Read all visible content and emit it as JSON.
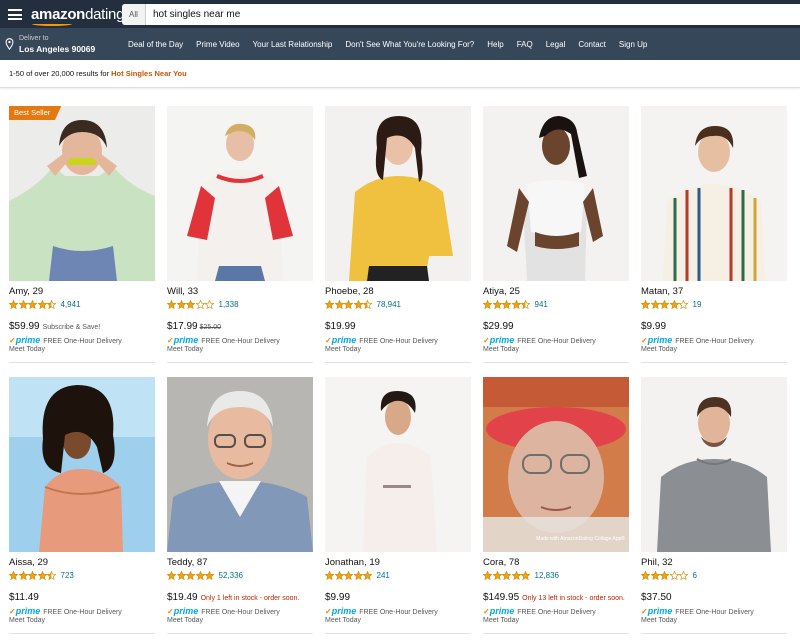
{
  "header": {
    "logo_brand": "amazon",
    "logo_suffix": "dating",
    "search_scope": "All",
    "search_query": "hot singles near me"
  },
  "nav": {
    "deliver_label": "Deliver to",
    "deliver_location": "Los Angeles 90069",
    "links": [
      "Deal of the Day",
      "Prime Video",
      "Your Last Relationship",
      "Don't See What You're Looking For?",
      "Help",
      "FAQ",
      "Legal",
      "Contact",
      "Sign Up"
    ]
  },
  "results": {
    "summary": "1-50 of over 20,000 results for ",
    "query": "Hot Singles Near You"
  },
  "common": {
    "prime_check": "✓",
    "prime_word": "prime",
    "delivery": "FREE One-Hour Delivery",
    "meet": "Meet Today"
  },
  "colors": {
    "header_bg": "#232f3e",
    "nav_bg": "#37475a",
    "accent_orange": "#e47911",
    "query_orange": "#c45500",
    "link_teal": "#007185",
    "prime_blue": "#00a8e1",
    "star_gold": "#f0a30e",
    "stock_red": "#b12704"
  },
  "products": [
    {
      "name": "Amy, 29",
      "stars": 4.5,
      "reviews": "4,941",
      "price": "$59.99",
      "old_price": "",
      "note": "Subscribe & Save!",
      "note_style": "gray",
      "badge": "Best Seller",
      "caption": ""
    },
    {
      "name": "Will, 33",
      "stars": 3,
      "reviews": "1,338",
      "price": "$17.99",
      "old_price": "$25.00",
      "note": "",
      "note_style": "",
      "badge": "",
      "caption": ""
    },
    {
      "name": "Phoebe, 28",
      "stars": 4.5,
      "reviews": "78,941",
      "price": "$19.99",
      "old_price": "",
      "note": "",
      "note_style": "",
      "badge": "",
      "caption": ""
    },
    {
      "name": "Atiya, 25",
      "stars": 4.5,
      "reviews": "941",
      "price": "$29.99",
      "old_price": "",
      "note": "",
      "note_style": "",
      "badge": "",
      "caption": ""
    },
    {
      "name": "Matan, 37",
      "stars": 4,
      "reviews": "19",
      "price": "$9.99",
      "old_price": "",
      "note": "",
      "note_style": "",
      "badge": "",
      "caption": ""
    },
    {
      "name": "Aissa, 29",
      "stars": 4.5,
      "reviews": "723",
      "price": "$11.49",
      "old_price": "",
      "note": "",
      "note_style": "",
      "badge": "",
      "caption": ""
    },
    {
      "name": "Teddy, 87",
      "stars": 5,
      "reviews": "52,336",
      "price": "$19.49",
      "old_price": "",
      "note": "Only 1 left in stock - order soon.",
      "note_style": "red",
      "badge": "",
      "caption": ""
    },
    {
      "name": "Jonathan, 19",
      "stars": 5,
      "reviews": "241",
      "price": "$9.99",
      "old_price": "",
      "note": "",
      "note_style": "",
      "badge": "",
      "caption": ""
    },
    {
      "name": "Cora, 78",
      "stars": 5,
      "reviews": "12,836",
      "price": "$149.95",
      "old_price": "",
      "note": "Only 13 left in stock - order soon.",
      "note_style": "red",
      "badge": "",
      "caption": "Made with AmazonDating Collage App®"
    },
    {
      "name": "Phil, 32",
      "stars": 3,
      "reviews": "6",
      "price": "$37.50",
      "old_price": "",
      "note": "",
      "note_style": "",
      "badge": "",
      "caption": ""
    }
  ]
}
